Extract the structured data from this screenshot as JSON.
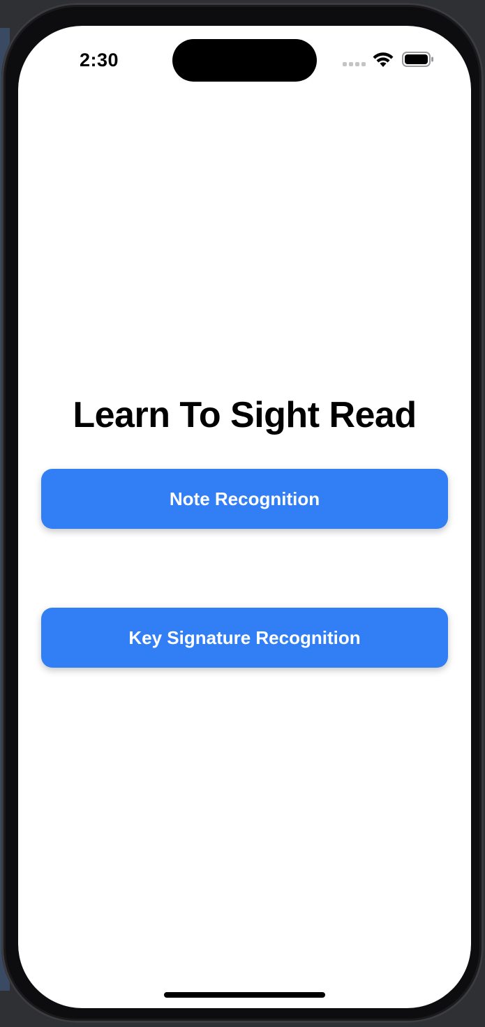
{
  "status_bar": {
    "time": "2:30",
    "icons": [
      "cellular-signal-icon",
      "wifi-icon",
      "battery-icon"
    ]
  },
  "main": {
    "title": "Learn To Sight Read",
    "buttons": [
      {
        "label": "Note Recognition"
      },
      {
        "label": "Key Signature Recognition"
      }
    ]
  },
  "colors": {
    "accent": "#327ff5",
    "background": "#ffffff",
    "text": "#000000"
  }
}
